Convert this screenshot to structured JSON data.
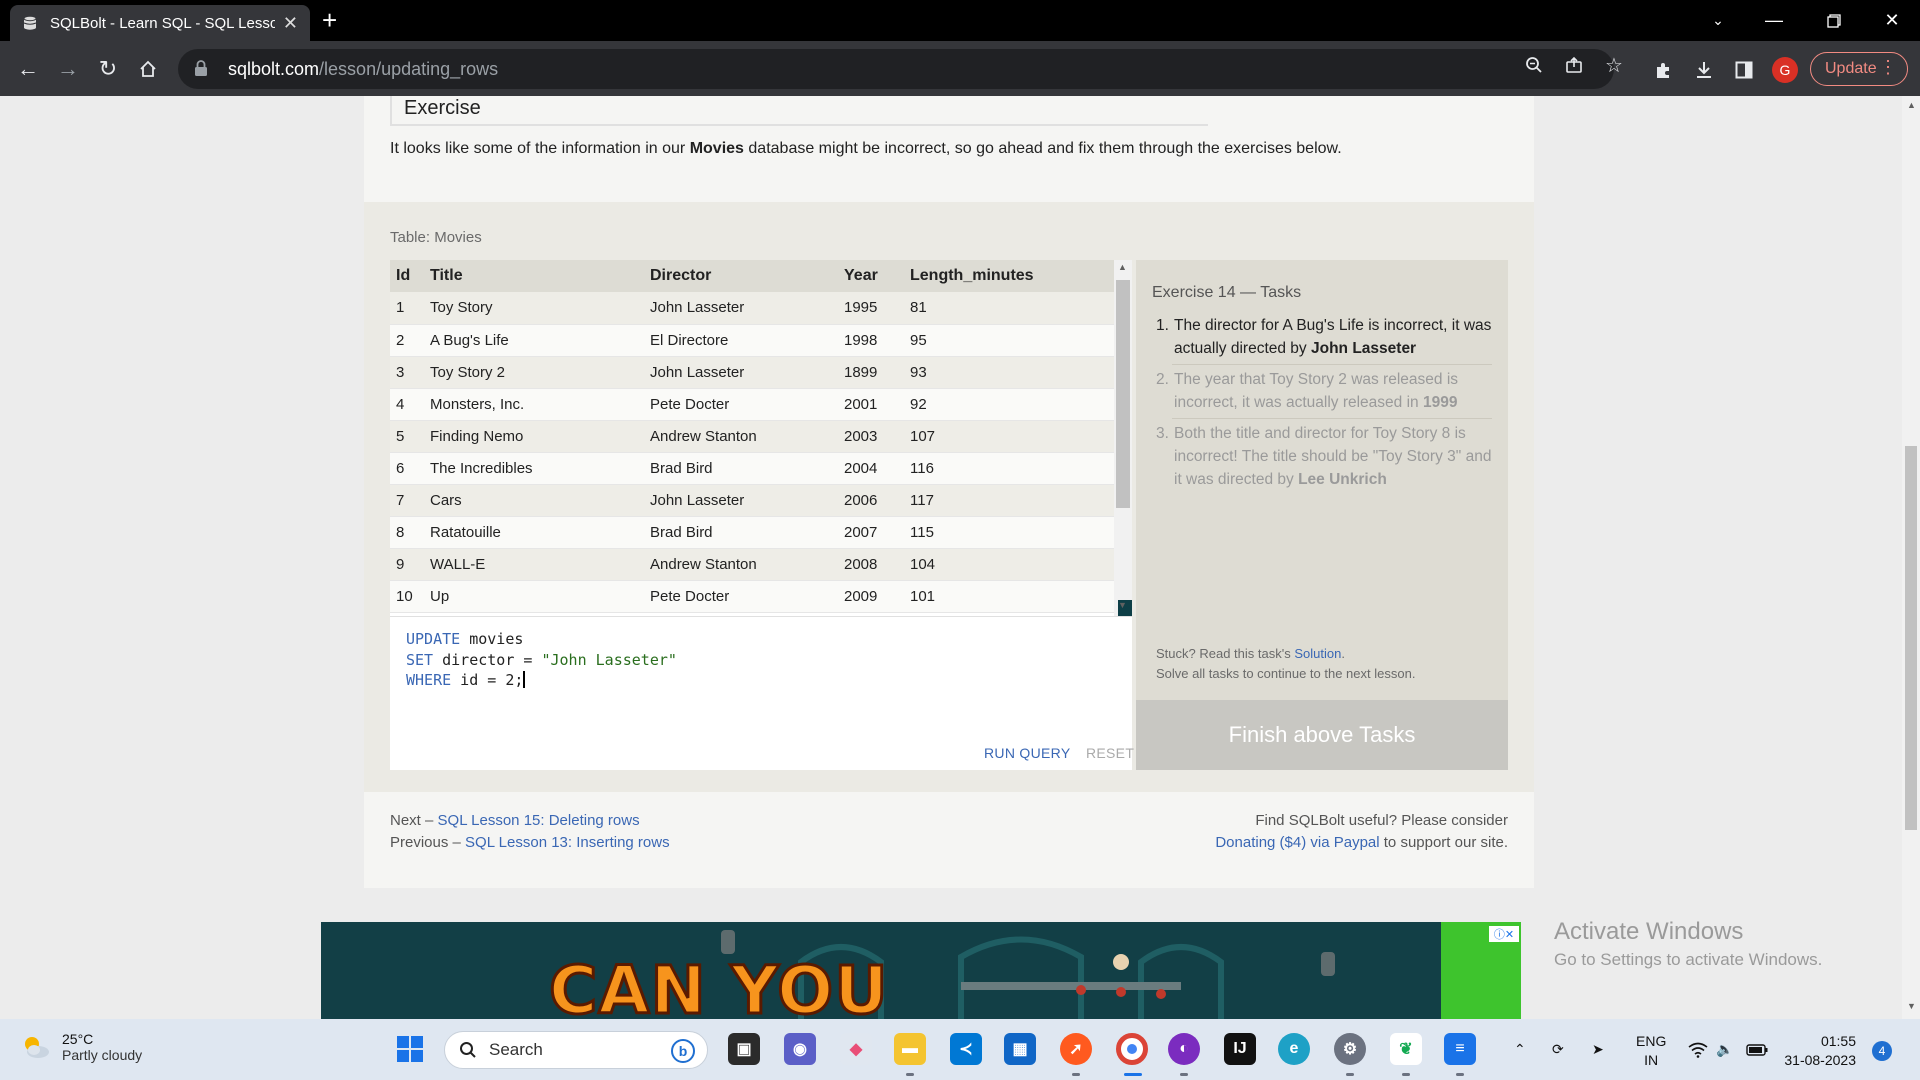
{
  "browser": {
    "tab_title": "SQLBolt - Learn SQL - SQL Lesso",
    "url_host": "sqlbolt.com",
    "url_path": "/lesson/updating_rows",
    "profile_initial": "G",
    "update_label": "Update"
  },
  "page": {
    "exercise_heading": "Exercise",
    "intro_prefix": "It looks like some of the information in our ",
    "intro_bold": "Movies",
    "intro_suffix": " database might be incorrect, so go ahead and fix them through the exercises below.",
    "table_label": "Table: Movies",
    "columns": [
      "Id",
      "Title",
      "Director",
      "Year",
      "Length_minutes"
    ],
    "rows": [
      [
        "1",
        "Toy Story",
        "John Lasseter",
        "1995",
        "81"
      ],
      [
        "2",
        "A Bug's Life",
        "El Directore",
        "1998",
        "95"
      ],
      [
        "3",
        "Toy Story 2",
        "John Lasseter",
        "1899",
        "93"
      ],
      [
        "4",
        "Monsters, Inc.",
        "Pete Docter",
        "2001",
        "92"
      ],
      [
        "5",
        "Finding Nemo",
        "Andrew Stanton",
        "2003",
        "107"
      ],
      [
        "6",
        "The Incredibles",
        "Brad Bird",
        "2004",
        "116"
      ],
      [
        "7",
        "Cars",
        "John Lasseter",
        "2006",
        "117"
      ],
      [
        "8",
        "Ratatouille",
        "Brad Bird",
        "2007",
        "115"
      ],
      [
        "9",
        "WALL-E",
        "Andrew Stanton",
        "2008",
        "104"
      ],
      [
        "10",
        "Up",
        "Pete Docter",
        "2009",
        "101"
      ]
    ],
    "query": {
      "line1_kw": "UPDATE",
      "line1_rest": " movies",
      "line2_kw": "SET",
      "line2_mid": " director = ",
      "line2_str": "\"John Lasseter\"",
      "line3_kw": "WHERE",
      "line3_rest": " id = 2;"
    },
    "run_label": "RUN QUERY",
    "reset_label": "RESET",
    "tasks_title": "Exercise 14 — Tasks",
    "tasks": [
      {
        "num": "1.",
        "text": "The director for A Bug's Life is incorrect, it was actually directed by ",
        "bold": "John Lasseter",
        "after": ""
      },
      {
        "num": "2.",
        "text": "The year that Toy Story 2 was released is incorrect, it was actually released in ",
        "bold": "1999",
        "after": ""
      },
      {
        "num": "3.",
        "text": "Both the title and director for Toy Story 8 is incorrect! The title should be \"Toy Story 3\" and it was directed by ",
        "bold": "Lee Unkrich",
        "after": ""
      }
    ],
    "stuck_prefix": "Stuck? Read this task's ",
    "stuck_link": "Solution",
    "stuck_suffix": ".",
    "stuck_line2": "Solve all tasks to continue to the next lesson.",
    "finish_label": "Finish above Tasks",
    "next_prefix": "Next – ",
    "next_link": "SQL Lesson 15: Deleting rows",
    "prev_prefix": "Previous – ",
    "prev_link": "SQL Lesson 13: Inserting rows",
    "support_line1": "Find SQLBolt useful? Please consider",
    "support_link": "Donating ($4) via Paypal",
    "support_suffix": " to support our site.",
    "ad_text": "CAN YOU"
  },
  "activate_windows": {
    "title": "Activate Windows",
    "subtitle": "Go to Settings to activate Windows."
  },
  "taskbar": {
    "temperature": "25°C",
    "weather": "Partly cloudy",
    "search_placeholder": "Search",
    "lang_line1": "ENG",
    "lang_line2": "IN",
    "time": "01:55",
    "date": "31-08-2023",
    "notifications": "4"
  },
  "colors": {
    "link": "#3a67b4",
    "update_accent": "#f28b82",
    "chrome_dark": "#35363a"
  }
}
